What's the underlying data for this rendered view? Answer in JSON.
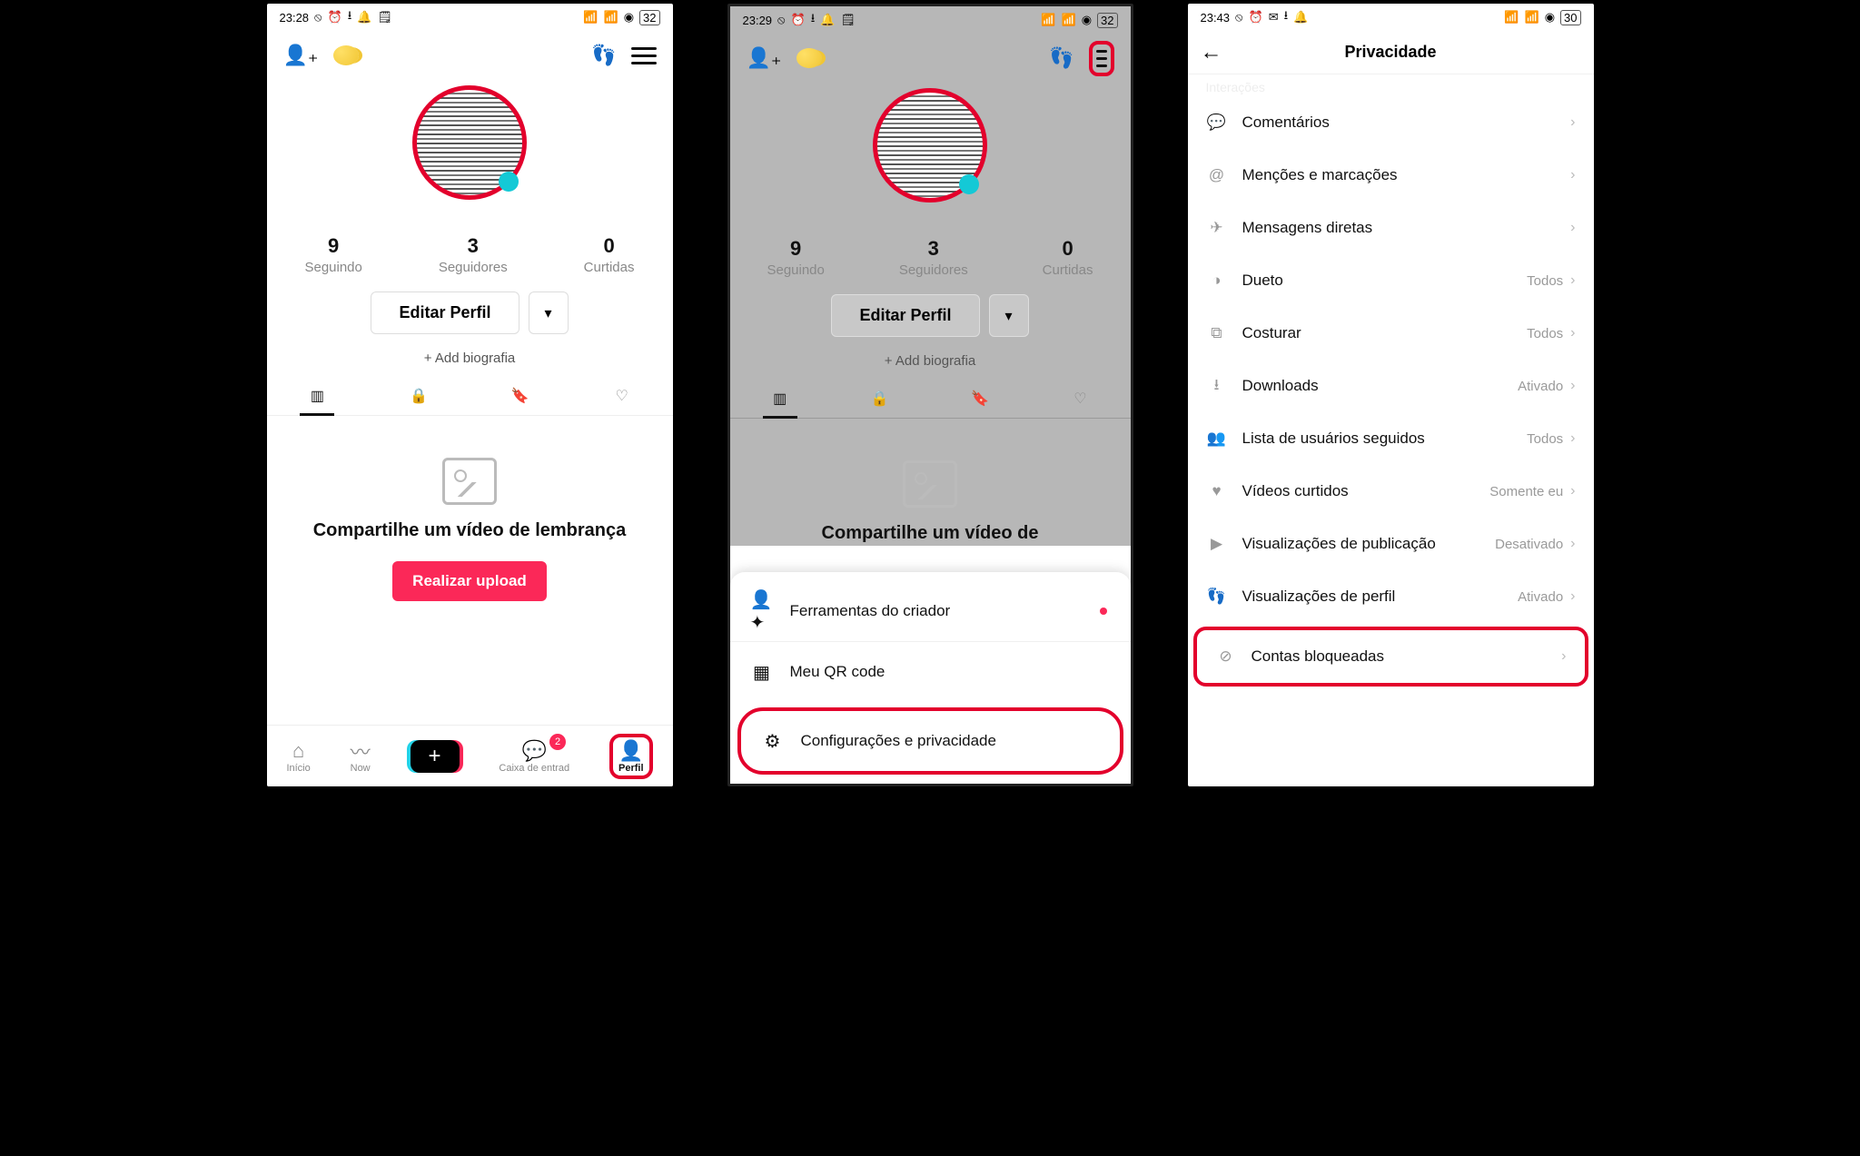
{
  "screen1": {
    "status": {
      "time": "23:28",
      "battery": "32"
    },
    "stats": {
      "following_count": "9",
      "following_label": "Seguindo",
      "followers_count": "3",
      "followers_label": "Seguidores",
      "likes_count": "0",
      "likes_label": "Curtidas"
    },
    "edit_profile": "Editar Perfil",
    "add_bio": "+ Add biografia",
    "empty_title": "Compartilhe um vídeo de lembrança",
    "upload_button": "Realizar upload",
    "nav": {
      "home": "Início",
      "now": "Now",
      "inbox": "Caixa de entrad",
      "inbox_badge": "2",
      "profile": "Perfil"
    }
  },
  "screen2": {
    "status": {
      "time": "23:29",
      "battery": "32"
    },
    "stats": {
      "following_count": "9",
      "following_label": "Seguindo",
      "followers_count": "3",
      "followers_label": "Seguidores",
      "likes_count": "0",
      "likes_label": "Curtidas"
    },
    "edit_profile": "Editar Perfil",
    "add_bio": "+ Add biografia",
    "empty_title": "Compartilhe um vídeo de",
    "sheet": {
      "creator_tools": "Ferramentas do criador",
      "qr_code": "Meu QR code",
      "settings_privacy": "Configurações e privacidade"
    }
  },
  "screen3": {
    "status": {
      "time": "23:43",
      "battery": "30"
    },
    "header_title": "Privacidade",
    "section_hint": "Interações",
    "items": {
      "comments": {
        "label": "Comentários",
        "value": ""
      },
      "mentions": {
        "label": "Menções e marcações",
        "value": ""
      },
      "dms": {
        "label": "Mensagens diretas",
        "value": ""
      },
      "duet": {
        "label": "Dueto",
        "value": "Todos"
      },
      "stitch": {
        "label": "Costurar",
        "value": "Todos"
      },
      "downloads": {
        "label": "Downloads",
        "value": "Ativado"
      },
      "following_list": {
        "label": "Lista de usuários seguidos",
        "value": "Todos"
      },
      "liked_videos": {
        "label": "Vídeos curtidos",
        "value": "Somente eu"
      },
      "post_views": {
        "label": "Visualizações de publicação",
        "value": "Desativado"
      },
      "profile_views": {
        "label": "Visualizações de perfil",
        "value": "Ativado"
      },
      "blocked": {
        "label": "Contas bloqueadas",
        "value": ""
      }
    }
  }
}
